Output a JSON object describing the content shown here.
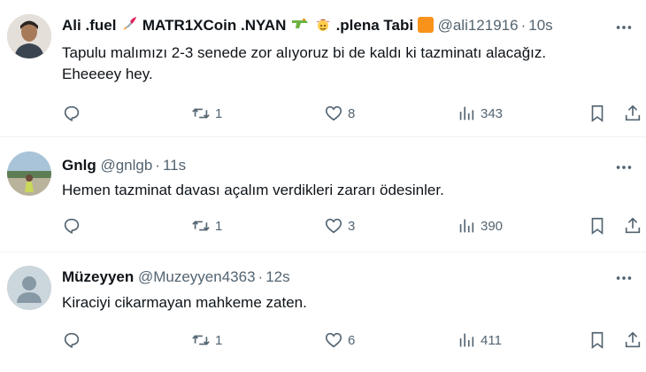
{
  "tweets": [
    {
      "name": ".fuel",
      "name_prefix": "Ali",
      "name_mid": "MATR1XCoin .NYAN",
      "name_suffix": ".plena Tabi",
      "handle": "@ali121916",
      "dot": "·",
      "time": "10s",
      "text_line1": "Tapulu malımızı 2-3 senede zor alıyoruz bi de kaldı ki tazminatı alacağız.",
      "text_line2": "Eheeeey hey.",
      "replies": "",
      "retweets": "1",
      "likes": "8",
      "views": "343",
      "badge_color": "#f7931a"
    },
    {
      "name": "Gnlg",
      "handle": "@gnlgb",
      "dot": "·",
      "time": "11s",
      "text_line1": "Hemen tazminat davası açalım verdikleri zararı ödesinler.",
      "replies": "",
      "retweets": "1",
      "likes": "3",
      "views": "390"
    },
    {
      "name": "Müzeyyen",
      "handle": "@Muzeyyen4363",
      "dot": "·",
      "time": "12s",
      "text_line1": "Kiraciyi cikarmayan mahkeme zaten.",
      "replies": "",
      "retweets": "1",
      "likes": "6",
      "views": "411"
    }
  ],
  "colors": {
    "text": "#0f1419",
    "secondary": "#536471",
    "divider": "#eff3f4",
    "accent_orange": "#f7931a"
  },
  "icons": [
    "reply-icon",
    "retweet-icon",
    "like-icon",
    "views-icon",
    "bookmark-icon",
    "share-icon",
    "more-icon",
    "rocket-icon",
    "water-gun-icon",
    "cowboy-emoji-icon"
  ]
}
